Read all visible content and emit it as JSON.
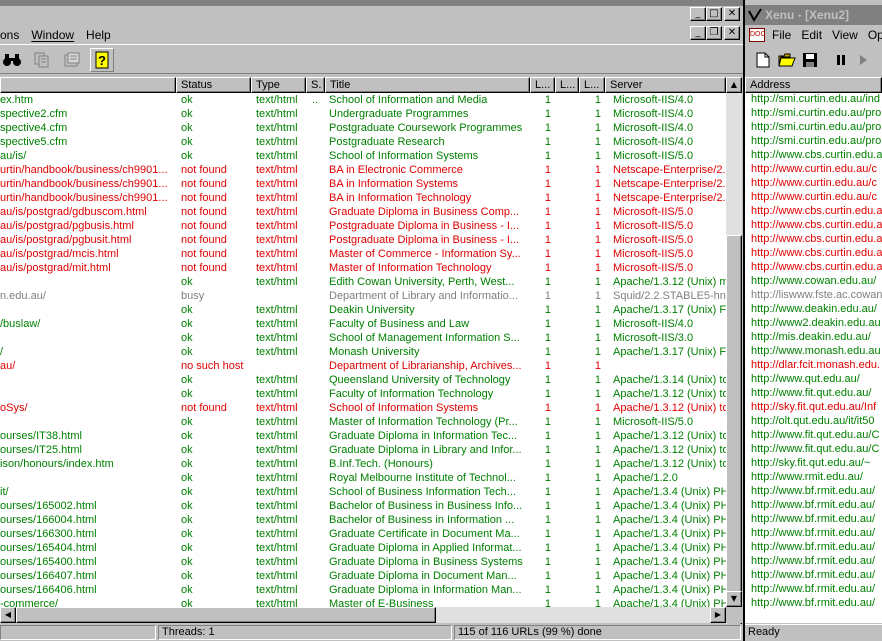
{
  "left_window": {
    "menus": [
      "ons",
      "Window",
      "Help"
    ],
    "toolbar_icons": [
      "binoculars-icon",
      "copy-icon",
      "properties-icon",
      "help-icon"
    ],
    "columns": [
      "",
      "Status",
      "Type",
      "S.",
      "Title",
      "L...",
      "L...",
      "L...",
      "Server"
    ],
    "rows": [
      {
        "url": "ex.htm",
        "status": "ok",
        "type": "text/html",
        "s": "..",
        "title": "School of Information and Media",
        "l1": "1",
        "l3": "1",
        "server": "Microsoft-IIS/4.0",
        "cls": "ok"
      },
      {
        "url": "spective2.cfm",
        "status": "ok",
        "type": "text/html",
        "s": "",
        "title": "Undergraduate Programmes",
        "l1": "1",
        "l3": "1",
        "server": "Microsoft-IIS/4.0",
        "cls": "ok"
      },
      {
        "url": "spective4.cfm",
        "status": "ok",
        "type": "text/html",
        "s": "",
        "title": "Postgraduate Coursework Programmes",
        "l1": "1",
        "l3": "1",
        "server": "Microsoft-IIS/4.0",
        "cls": "ok"
      },
      {
        "url": "spective5.cfm",
        "status": "ok",
        "type": "text/html",
        "s": "",
        "title": "Postgraduate Research",
        "l1": "1",
        "l3": "1",
        "server": "Microsoft-IIS/4.0",
        "cls": "ok"
      },
      {
        "url": "au/is/",
        "status": "ok",
        "type": "text/html",
        "s": "",
        "title": "School of Information Systems",
        "l1": "1",
        "l3": "1",
        "server": "Microsoft-IIS/5.0",
        "cls": "ok"
      },
      {
        "url": "urtin/handbook/business/ch9901...",
        "status": "not found",
        "type": "text/html",
        "s": "",
        "title": "BA in Electronic Commerce",
        "l1": "1",
        "l3": "1",
        "server": "Netscape-Enterprise/2.",
        "cls": "bad"
      },
      {
        "url": "urtin/handbook/business/ch9901...",
        "status": "not found",
        "type": "text/html",
        "s": "",
        "title": "BA in Information Systems",
        "l1": "1",
        "l3": "1",
        "server": "Netscape-Enterprise/2.",
        "cls": "bad"
      },
      {
        "url": "urtin/handbook/business/ch9901...",
        "status": "not found",
        "type": "text/html",
        "s": "",
        "title": "BA in Information Technology",
        "l1": "1",
        "l3": "1",
        "server": "Netscape-Enterprise/2.",
        "cls": "bad"
      },
      {
        "url": "au/is/postgrad/gdbuscom.html",
        "status": "not found",
        "type": "text/html",
        "s": "",
        "title": "Graduate Diploma in Business Comp...",
        "l1": "1",
        "l3": "1",
        "server": "Microsoft-IIS/5.0",
        "cls": "bad"
      },
      {
        "url": "au/is/postgrad/pgbusis.html",
        "status": "not found",
        "type": "text/html",
        "s": "",
        "title": "Postgraduate Diploma in Business - I...",
        "l1": "1",
        "l3": "1",
        "server": "Microsoft-IIS/5.0",
        "cls": "bad"
      },
      {
        "url": "au/is/postgrad/pgbusit.html",
        "status": "not found",
        "type": "text/html",
        "s": "",
        "title": "Postgraduate Diploma in Business - I...",
        "l1": "1",
        "l3": "1",
        "server": "Microsoft-IIS/5.0",
        "cls": "bad"
      },
      {
        "url": "au/is/postgrad/mcis.html",
        "status": "not found",
        "type": "text/html",
        "s": "",
        "title": "Master of Commerce - Information Sy...",
        "l1": "1",
        "l3": "1",
        "server": "Microsoft-IIS/5.0",
        "cls": "bad"
      },
      {
        "url": "au/is/postgrad/mit.html",
        "status": "not found",
        "type": "text/html",
        "s": "",
        "title": "Master of Information Technology",
        "l1": "1",
        "l3": "1",
        "server": "Microsoft-IIS/5.0",
        "cls": "bad"
      },
      {
        "url": "",
        "status": "ok",
        "type": "text/html",
        "s": "",
        "title": "Edith Cowan University, Perth, West...",
        "l1": "1",
        "l3": "1",
        "server": "Apache/1.3.12 (Unix) m",
        "cls": "ok"
      },
      {
        "url": "n.edu.au/",
        "status": "busy",
        "type": "",
        "s": "",
        "title": "Department of Library and Informatio...",
        "l1": "1",
        "l3": "1",
        "server": "Squid/2.2.STABLE5-hn",
        "cls": "gray"
      },
      {
        "url": "",
        "status": "ok",
        "type": "text/html",
        "s": "",
        "title": "Deakin University",
        "l1": "1",
        "l3": "1",
        "server": "Apache/1.3.17 (Unix) F",
        "cls": "ok"
      },
      {
        "url": "/buslaw/",
        "status": "ok",
        "type": "text/html",
        "s": "",
        "title": "Faculty of Business and Law",
        "l1": "1",
        "l3": "1",
        "server": "Microsoft-IIS/4.0",
        "cls": "ok"
      },
      {
        "url": "",
        "status": "ok",
        "type": "text/html",
        "s": "",
        "title": "School of Management Information S...",
        "l1": "1",
        "l3": "1",
        "server": "Microsoft-IIS/3.0",
        "cls": "ok"
      },
      {
        "url": "/",
        "status": "ok",
        "type": "text/html",
        "s": "",
        "title": "Monash University",
        "l1": "1",
        "l3": "1",
        "server": "Apache/1.3.17 (Unix) F",
        "cls": "ok"
      },
      {
        "url": "au/",
        "status": "no such host",
        "type": "",
        "s": "",
        "title": "Department of Librarianship, Archives...",
        "l1": "1",
        "l3": "1",
        "server": "",
        "cls": "bad"
      },
      {
        "url": "",
        "status": "ok",
        "type": "text/html",
        "s": "",
        "title": "Queensland University of Technology",
        "l1": "1",
        "l3": "1",
        "server": "Apache/1.3.14 (Unix) to",
        "cls": "ok"
      },
      {
        "url": "",
        "status": "ok",
        "type": "text/html",
        "s": "",
        "title": "Faculty of Information Technology",
        "l1": "1",
        "l3": "1",
        "server": "Apache/1.3.12 (Unix) to",
        "cls": "ok"
      },
      {
        "url": "oSys/",
        "status": "not found",
        "type": "text/html",
        "s": "",
        "title": "School of Information Systems",
        "l1": "1",
        "l3": "1",
        "server": "Apache/1.3.12 (Unix) to",
        "cls": "bad"
      },
      {
        "url": "",
        "status": "ok",
        "type": "text/html",
        "s": "",
        "title": "Master of Information Technology (Pr...",
        "l1": "1",
        "l3": "1",
        "server": "Microsoft-IIS/5.0",
        "cls": "ok"
      },
      {
        "url": "ourses/IT38.html",
        "status": "ok",
        "type": "text/html",
        "s": "",
        "title": "Graduate Diploma in Information Tec...",
        "l1": "1",
        "l3": "1",
        "server": "Apache/1.3.12 (Unix) to",
        "cls": "ok"
      },
      {
        "url": "ourses/IT25.html",
        "status": "ok",
        "type": "text/html",
        "s": "",
        "title": "Graduate Diploma in Library and Infor...",
        "l1": "1",
        "l3": "1",
        "server": "Apache/1.3.12 (Unix) to",
        "cls": "ok"
      },
      {
        "url": "ison/honours/index.htm",
        "status": "ok",
        "type": "text/html",
        "s": "",
        "title": "B.Inf.Tech. (Honours)",
        "l1": "1",
        "l3": "1",
        "server": "Apache/1.3.12 (Unix) to",
        "cls": "ok"
      },
      {
        "url": "",
        "status": "ok",
        "type": "text/html",
        "s": "",
        "title": "Royal Melbourne Institute of Technol...",
        "l1": "1",
        "l3": "1",
        "server": "Apache/1.2.0",
        "cls": "ok"
      },
      {
        "url": "it/",
        "status": "ok",
        "type": "text/html",
        "s": "",
        "title": "School of Business Information Tech...",
        "l1": "1",
        "l3": "1",
        "server": "Apache/1.3.4 (Unix) PH",
        "cls": "ok"
      },
      {
        "url": "ourses/165002.html",
        "status": "ok",
        "type": "text/html",
        "s": "",
        "title": "Bachelor of Business in Business Info...",
        "l1": "1",
        "l3": "1",
        "server": "Apache/1.3.4 (Unix) PH",
        "cls": "ok"
      },
      {
        "url": "ourses/166004.html",
        "status": "ok",
        "type": "text/html",
        "s": "",
        "title": "Bachelor of Business in Information ...",
        "l1": "1",
        "l3": "1",
        "server": "Apache/1.3.4 (Unix) PH",
        "cls": "ok"
      },
      {
        "url": "ourses/166300.html",
        "status": "ok",
        "type": "text/html",
        "s": "",
        "title": "Graduate Certificate in Document Ma...",
        "l1": "1",
        "l3": "1",
        "server": "Apache/1.3.4 (Unix) PH",
        "cls": "ok"
      },
      {
        "url": "ourses/165404.html",
        "status": "ok",
        "type": "text/html",
        "s": "",
        "title": "Graduate Diploma in Applied Informat...",
        "l1": "1",
        "l3": "1",
        "server": "Apache/1.3.4 (Unix) PH",
        "cls": "ok"
      },
      {
        "url": "ourses/165400.html",
        "status": "ok",
        "type": "text/html",
        "s": "",
        "title": "Graduate Diploma in Business Systems",
        "l1": "1",
        "l3": "1",
        "server": "Apache/1.3.4 (Unix) PH",
        "cls": "ok"
      },
      {
        "url": "ourses/166407.html",
        "status": "ok",
        "type": "text/html",
        "s": "",
        "title": "Graduate Diploma in Document Man...",
        "l1": "1",
        "l3": "1",
        "server": "Apache/1.3.4 (Unix) PH",
        "cls": "ok"
      },
      {
        "url": "ourses/166406.html",
        "status": "ok",
        "type": "text/html",
        "s": "",
        "title": "Graduate Diploma in Information Man...",
        "l1": "1",
        "l3": "1",
        "server": "Apache/1.3.4 (Unix) PH",
        "cls": "ok"
      },
      {
        "url": "-commerce/",
        "status": "ok",
        "type": "text/html",
        "s": "",
        "title": "Master of E-Business",
        "l1": "1",
        "l3": "1",
        "server": "Apache/1.3.4 (Unix) PH",
        "cls": "ok"
      }
    ],
    "status_threads": "Threads: 1",
    "status_progress": "115 of 116 URLs (99 %) done"
  },
  "right_window": {
    "title": "Xenu - [Xenu2]",
    "menus": [
      "File",
      "Edit",
      "View",
      "Opt"
    ],
    "doc_icon_text": "DOC",
    "column_header": "Address",
    "rows": [
      {
        "addr": "http://smi.curtin.edu.au/ind",
        "cls": "ok"
      },
      {
        "addr": "http://smi.curtin.edu.au/pro",
        "cls": "ok"
      },
      {
        "addr": "http://smi.curtin.edu.au/pro",
        "cls": "ok"
      },
      {
        "addr": "http://smi.curtin.edu.au/pro",
        "cls": "ok"
      },
      {
        "addr": "http://www.cbs.curtin.edu.a",
        "cls": "ok"
      },
      {
        "addr": "http://www.curtin.edu.au/c",
        "cls": "bad"
      },
      {
        "addr": "http://www.curtin.edu.au/c",
        "cls": "bad"
      },
      {
        "addr": "http://www.curtin.edu.au/c",
        "cls": "bad"
      },
      {
        "addr": "http://www.cbs.curtin.edu.a",
        "cls": "bad"
      },
      {
        "addr": "http://www.cbs.curtin.edu.a",
        "cls": "bad"
      },
      {
        "addr": "http://www.cbs.curtin.edu.a",
        "cls": "bad"
      },
      {
        "addr": "http://www.cbs.curtin.edu.a",
        "cls": "bad"
      },
      {
        "addr": "http://www.cbs.curtin.edu.a",
        "cls": "bad"
      },
      {
        "addr": "http://www.cowan.edu.au/",
        "cls": "ok"
      },
      {
        "addr": "http://liswww.fste.ac.cowan",
        "cls": "gray"
      },
      {
        "addr": "http://www.deakin.edu.au/",
        "cls": "ok"
      },
      {
        "addr": "http://www2.deakin.edu.au",
        "cls": "ok"
      },
      {
        "addr": "http://mis.deakin.edu.au/",
        "cls": "ok"
      },
      {
        "addr": "http://www.monash.edu.au",
        "cls": "ok"
      },
      {
        "addr": "http://dlar.fcit.monash.edu.",
        "cls": "bad"
      },
      {
        "addr": "http://www.qut.edu.au/",
        "cls": "ok"
      },
      {
        "addr": "http://www.fit.qut.edu.au/",
        "cls": "ok"
      },
      {
        "addr": "http://sky.fit.qut.edu.au/Inf",
        "cls": "bad"
      },
      {
        "addr": "http://olt.qut.edu.au/it/it50",
        "cls": "ok"
      },
      {
        "addr": "http://www.fit.qut.edu.au/C",
        "cls": "ok"
      },
      {
        "addr": "http://www.fit.qut.edu.au/C",
        "cls": "ok"
      },
      {
        "addr": "http://sky.fit.qut.edu.au/~",
        "cls": "ok"
      },
      {
        "addr": "http://www.rmit.edu.au/",
        "cls": "ok"
      },
      {
        "addr": "http://www.bf.rmit.edu.au/",
        "cls": "ok"
      },
      {
        "addr": "http://www.bf.rmit.edu.au/",
        "cls": "ok"
      },
      {
        "addr": "http://www.bf.rmit.edu.au/",
        "cls": "ok"
      },
      {
        "addr": "http://www.bf.rmit.edu.au/",
        "cls": "ok"
      },
      {
        "addr": "http://www.bf.rmit.edu.au/",
        "cls": "ok"
      },
      {
        "addr": "http://www.bf.rmit.edu.au/",
        "cls": "ok"
      },
      {
        "addr": "http://www.bf.rmit.edu.au/",
        "cls": "ok"
      },
      {
        "addr": "http://www.bf.rmit.edu.au/",
        "cls": "ok"
      },
      {
        "addr": "http://www.bf.rmit.edu.au/",
        "cls": "ok"
      }
    ],
    "status": "Ready"
  },
  "colors": {
    "ok": "#008000",
    "error": "#e00000",
    "busy": "#808080",
    "chrome": "#c0c0c0"
  }
}
